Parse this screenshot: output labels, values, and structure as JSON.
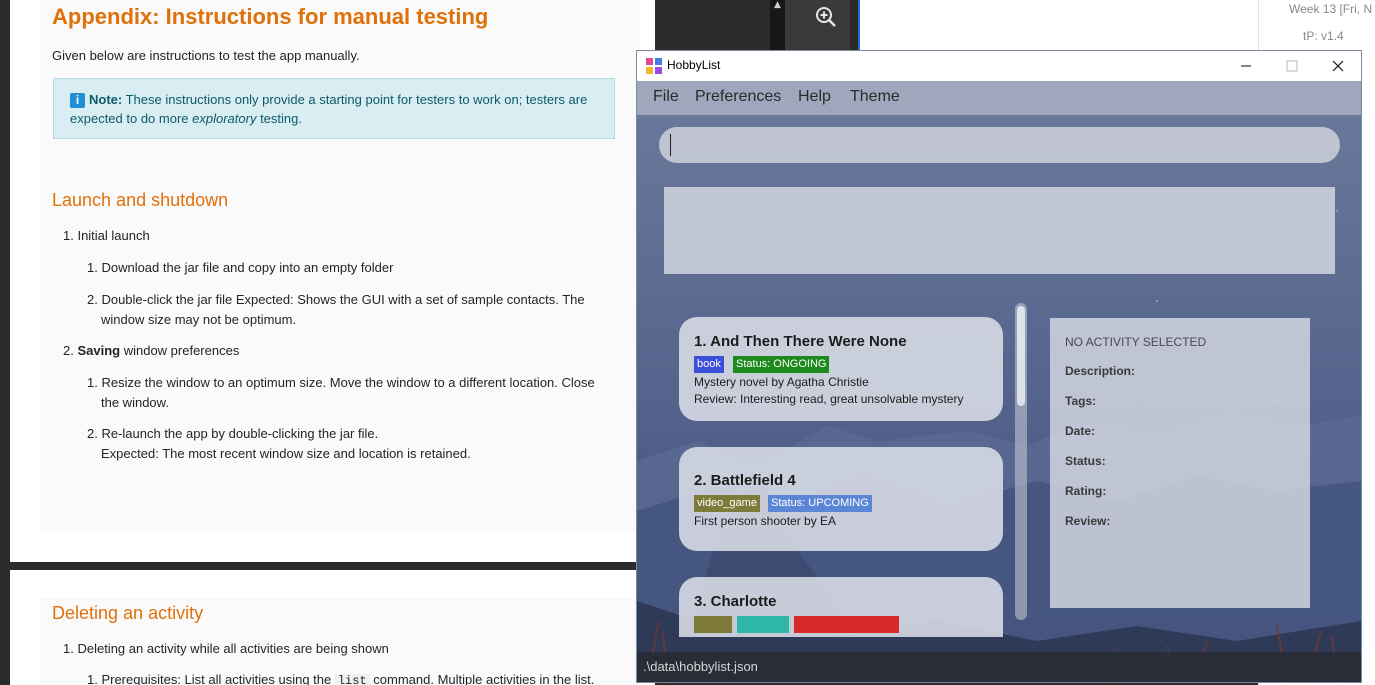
{
  "doc": {
    "heading": "Appendix: Instructions for manual testing",
    "intro": "Given below are instructions to test the app manually.",
    "note": {
      "label": "Note:",
      "text_a": "These instructions only provide a starting point for testers to work on; testers are expected to do more ",
      "emph": "exploratory",
      "text_b": " testing."
    },
    "section1": {
      "title": "Launch and shutdown",
      "items": [
        "1. Initial launch",
        "1. Download the jar file and copy into an empty folder",
        "2. Double-click the jar file Expected: Shows the GUI with a set of sample contacts. The",
        "window size may not be optimum.",
        "2.",
        "Saving",
        " window preferences",
        "1. Resize the window to an optimum size. Move the window to a different location. Close",
        "the window.",
        "2. Re-launch the app by double-clicking the jar file.",
        "Expected: The most recent window size and location is retained."
      ]
    },
    "section2": {
      "title": "Deleting an activity",
      "items": [
        "1. Deleting an activity while all activities are being shown",
        "1. Prerequisites: List all activities using the ",
        "list",
        " command. Multiple activities in the list."
      ]
    }
  },
  "right_side": {
    "week": "Week 13 [Fri, N",
    "version": "tP: v1.4"
  },
  "window": {
    "title": "HobbyList",
    "menu": [
      "File",
      "Preferences",
      "Help",
      "Theme"
    ],
    "command_input": "",
    "activities": [
      {
        "index_title": "1.  And Then There Were None",
        "tag": "book",
        "status": "Status: ONGOING",
        "description": "Mystery novel by Agatha Christie",
        "review": "Review: Interesting read, great unsolvable mystery"
      },
      {
        "index_title": "2.  Battlefield 4",
        "tag": "video_game",
        "status": "Status: UPCOMING",
        "description": "First person shooter by EA"
      },
      {
        "index_title": "3.  Charlotte"
      }
    ],
    "detail": {
      "header": "NO ACTIVITY SELECTED",
      "labels": [
        "Description:",
        "Tags:",
        "Date:",
        "Status:",
        "Rating:",
        "Review:"
      ]
    },
    "status_path": ".\\data\\hobbylist.json"
  },
  "colors": {
    "doc_orange": "#e0700a",
    "tag_book": "#3b4fd8",
    "status_ongoing": "#1d8a1d",
    "tag_video_game": "#7d7a3a",
    "status_upcoming": "#5b86d6",
    "card3_tag_a": "#7d7a3a",
    "card3_tag_b": "#2fb7a7",
    "card3_tag_c": "#d82a2a"
  }
}
